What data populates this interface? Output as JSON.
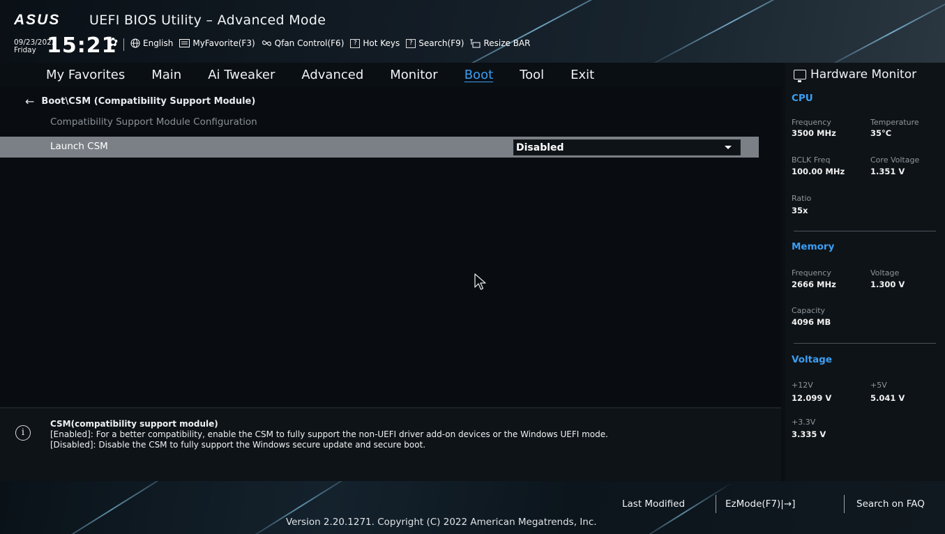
{
  "header": {
    "brand": "ASUS",
    "title": "UEFI BIOS Utility – Advanced Mode",
    "date": "09/23/2022",
    "day": "Friday",
    "time": "15:21",
    "toolbar": [
      {
        "label": "English",
        "icon": "globe-icon"
      },
      {
        "label": "MyFavorite(F3)",
        "icon": "favorite-icon"
      },
      {
        "label": "Qfan Control(F6)",
        "icon": "fan-icon"
      },
      {
        "label": "Hot Keys",
        "icon": "question-box-icon"
      },
      {
        "label": "Search(F9)",
        "icon": "question-box-icon"
      },
      {
        "label": "Resize BAR",
        "icon": "resize-bar-icon"
      }
    ]
  },
  "nav": {
    "items": [
      "My Favorites",
      "Main",
      "Ai Tweaker",
      "Advanced",
      "Monitor",
      "Boot",
      "Tool",
      "Exit"
    ],
    "active": "Boot"
  },
  "main": {
    "breadcrumb": "Boot\\CSM (Compatibility Support Module)",
    "subtitle": "Compatibility Support Module Configuration",
    "setting": {
      "label": "Launch CSM",
      "value": "Disabled"
    }
  },
  "help": {
    "line1": "CSM(compatibility support module)",
    "line2": "[Enabled]: For a better compatibility, enable the CSM to fully support the non-UEFI driver add-on devices or the Windows UEFI mode.",
    "line3": "[Disabled]: Disable the CSM to fully support the Windows secure update and secure boot."
  },
  "hw_monitor": {
    "title": "Hardware Monitor",
    "cpu": {
      "title": "CPU",
      "frequency_label": "Frequency",
      "frequency": "3500 MHz",
      "temperature_label": "Temperature",
      "temperature": "35°C",
      "bclk_label": "BCLK Freq",
      "bclk": "100.00 MHz",
      "core_voltage_label": "Core Voltage",
      "core_voltage": "1.351 V",
      "ratio_label": "Ratio",
      "ratio": "35x"
    },
    "memory": {
      "title": "Memory",
      "frequency_label": "Frequency",
      "frequency": "2666 MHz",
      "voltage_label": "Voltage",
      "voltage": "1.300 V",
      "capacity_label": "Capacity",
      "capacity": "4096 MB"
    },
    "voltage": {
      "title": "Voltage",
      "v12_label": "+12V",
      "v12": "12.099 V",
      "v5_label": "+5V",
      "v5": "5.041 V",
      "v33_label": "+3.3V",
      "v33": "3.335 V"
    }
  },
  "footer": {
    "last_modified": "Last Modified",
    "ezmode": "EzMode(F7)|→]",
    "search_faq": "Search on FAQ",
    "version": "Version 2.20.1271. Copyright (C) 2022 American Megatrends, Inc."
  },
  "colors": {
    "accent": "#3b9ef3",
    "row_highlight": "#7b8087",
    "background": "#090d11"
  }
}
